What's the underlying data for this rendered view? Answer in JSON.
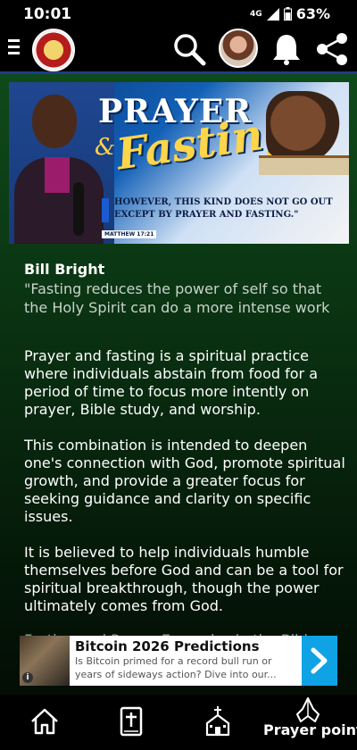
{
  "status_bar": {
    "time": "10:01",
    "network": "4G",
    "battery": "63%"
  },
  "banner": {
    "title_line1": "PRAYER",
    "amp": "&",
    "title_line2": "Fasting",
    "quote": "HOWEVER, THIS KIND DOES NOT GO OUT EXCEPT BY PRAYER AND FASTING.\"",
    "reference": "MATTHEW 17:21"
  },
  "quote": {
    "author": "Bill Bright",
    "text": "\"Fasting reduces the power of self so that the Holy Spirit can do a more intense work"
  },
  "article": {
    "p1": "Prayer and fasting is a spiritual practice where individuals abstain from food for a period of time to focus more intently on prayer, Bible study, and worship.",
    "p2": " This combination is intended to deepen one's connection with God, promote spiritual growth, and provide a greater focus for seeking guidance and clarity on specific issues.",
    "p3": " It is believed to help individuals humble themselves before God and can be a tool for spiritual breakthrough, though the power ultimately comes from God.",
    "p4": "Fasting and Prayer Examples in the Bible"
  },
  "ad": {
    "title": "Bitcoin 2026 Predictions",
    "description": "Is Bitcoin primed for a record bull run or years of sideways action? Dive into our...",
    "info_icon": "i"
  },
  "bottom_nav": {
    "active_label": "Prayer point"
  },
  "colors": {
    "accent": "#1e3c8c",
    "ad_arrow": "#0fa3e6",
    "banner_script": "#ffd54a"
  },
  "icons": [
    "menu-icon",
    "search-icon",
    "bell-icon",
    "share-icon",
    "home-icon",
    "bible-icon",
    "church-icon",
    "praying-hands-icon",
    "chevron-right-icon"
  ]
}
